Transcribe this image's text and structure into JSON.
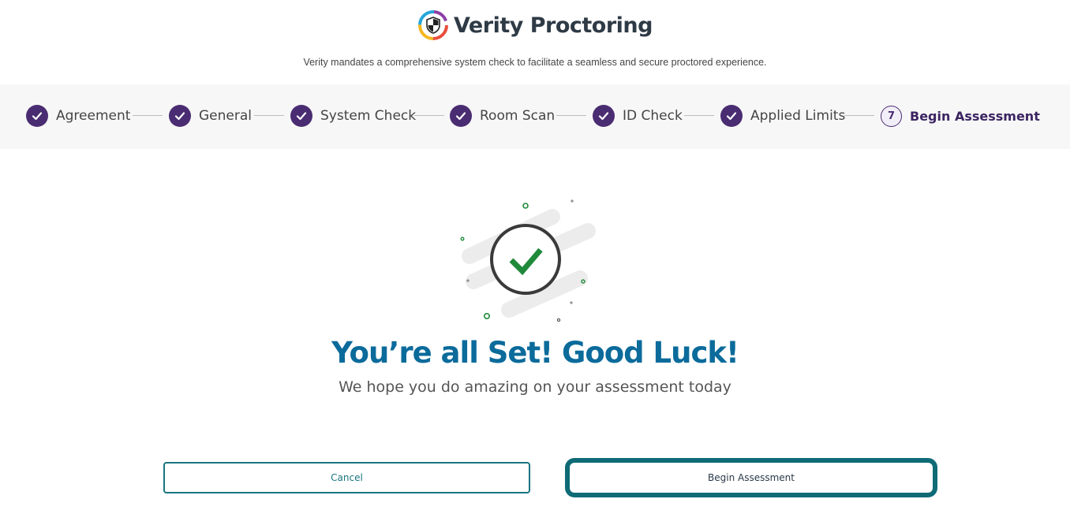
{
  "brand": {
    "name": "Verity Proctoring",
    "subtitle": "Verity mandates a comprehensive system check to facilitate a seamless and secure proctored experience."
  },
  "steps": [
    {
      "label": "Agreement",
      "status": "complete"
    },
    {
      "label": "General",
      "status": "complete"
    },
    {
      "label": "System Check",
      "status": "complete"
    },
    {
      "label": "Room Scan",
      "status": "complete"
    },
    {
      "label": "ID Check",
      "status": "complete"
    },
    {
      "label": "Applied Limits",
      "status": "complete"
    },
    {
      "label": "Begin Assessment",
      "status": "current",
      "number": "7"
    }
  ],
  "main": {
    "headline": "You’re all Set! Good Luck!",
    "message": "We hope you do amazing on your assessment today"
  },
  "actions": {
    "cancel_label": "Cancel",
    "begin_label": "Begin Assessment"
  },
  "colors": {
    "step_purple": "#4a2c72",
    "headline_blue": "#0b6b9b",
    "button_teal": "#1a7580",
    "check_green": "#1f8a3a"
  }
}
